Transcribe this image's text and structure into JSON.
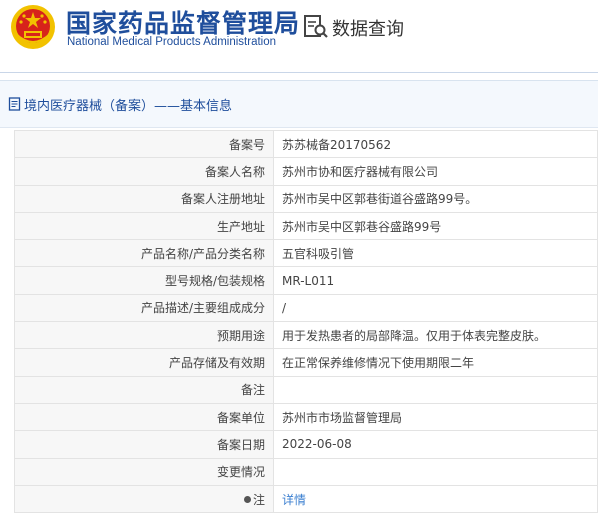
{
  "site": {
    "name_cn": "国家药品监督管理局",
    "name_en": "National Medical Products Administration",
    "query_label": "数据查询"
  },
  "panel": {
    "title": "境内医疗器械（备案）——基本信息"
  },
  "rows": [
    {
      "label": "备案号",
      "value": "苏苏械备20170562"
    },
    {
      "label": "备案人名称",
      "value": "苏州市协和医疗器械有限公司"
    },
    {
      "label": "备案人注册地址",
      "value": "苏州市吴中区郭巷街道谷盛路99号。"
    },
    {
      "label": "生产地址",
      "value": "苏州市吴中区郭巷谷盛路99号"
    },
    {
      "label": "产品名称/产品分类名称",
      "value": "五官科吸引管"
    },
    {
      "label": "型号规格/包装规格",
      "value": "MR-L011"
    },
    {
      "label": "产品描述/主要组成成分",
      "value": "/"
    },
    {
      "label": "预期用途",
      "value": "用于发热患者的局部降温。仅用于体表完整皮肤。"
    },
    {
      "label": "产品存储及有效期",
      "value": "在正常保养维修情况下使用期限二年"
    },
    {
      "label": "备注",
      "value": ""
    },
    {
      "label": "备案单位",
      "value": "苏州市市场监督管理局"
    },
    {
      "label": "备案日期",
      "value": "2022-06-08"
    },
    {
      "label": "变更情况",
      "value": ""
    },
    {
      "label": "注",
      "value": "详情"
    }
  ],
  "colors": {
    "brand": "#1f4e9c",
    "link": "#3b7fd0",
    "emblem_red": "#d7231b",
    "emblem_gold": "#f2c200"
  }
}
